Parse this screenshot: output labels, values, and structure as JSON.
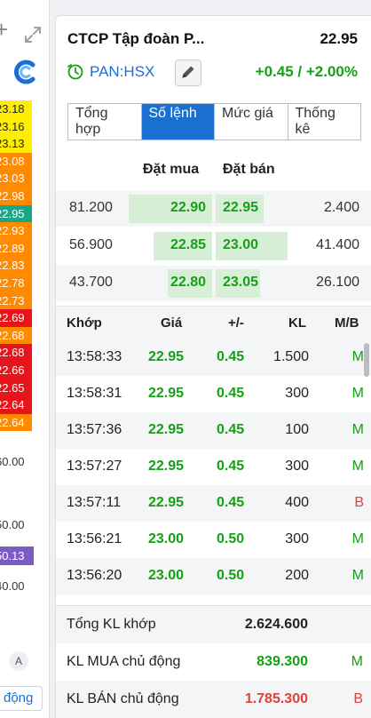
{
  "left_strip": {
    "price_tags": [
      {
        "text": "23.18",
        "bg": "#ffee00",
        "fg": "#222222"
      },
      {
        "text": "23.16",
        "bg": "#ffee00",
        "fg": "#222222"
      },
      {
        "text": "23.13",
        "bg": "#ffee00",
        "fg": "#222222"
      },
      {
        "text": "23.08",
        "bg": "#ff8a00",
        "fg": "#ffffff"
      },
      {
        "text": "23.03",
        "bg": "#ff8a00",
        "fg": "#ffffff"
      },
      {
        "text": "22.98",
        "bg": "#ff8a00",
        "fg": "#ffffff"
      },
      {
        "text": "22.95",
        "bg": "#16a889",
        "fg": "#ffffff"
      },
      {
        "text": "22.93",
        "bg": "#ff8a00",
        "fg": "#ffffff"
      },
      {
        "text": "22.89",
        "bg": "#ff8a00",
        "fg": "#ffffff"
      },
      {
        "text": "22.83",
        "bg": "#ff8a00",
        "fg": "#ffffff"
      },
      {
        "text": "22.78",
        "bg": "#ff8a00",
        "fg": "#ffffff"
      },
      {
        "text": "22.73",
        "bg": "#ff8a00",
        "fg": "#ffffff"
      },
      {
        "text": "22.69",
        "bg": "#e8141c",
        "fg": "#ffffff"
      },
      {
        "text": "22.68",
        "bg": "#ff8a00",
        "fg": "#ffffff"
      },
      {
        "text": "22.68",
        "bg": "#e8141c",
        "fg": "#ffffff"
      },
      {
        "text": "22.66",
        "bg": "#e8141c",
        "fg": "#ffffff"
      },
      {
        "text": "22.65",
        "bg": "#e8141c",
        "fg": "#ffffff"
      },
      {
        "text": "22.64",
        "bg": "#e8141c",
        "fg": "#ffffff"
      },
      {
        "text": "22.64",
        "bg": "#ff8a00",
        "fg": "#ffffff"
      }
    ],
    "axis_labels": [
      "60.00",
      "50.00",
      "40.00"
    ],
    "volume_tag": "50.13",
    "a_button": "A",
    "dong_button": "động"
  },
  "header": {
    "name": "CTCP Tập đoàn P...",
    "price": "22.95",
    "exchange": "PAN:HSX",
    "change": "+0.45 / +2.00%"
  },
  "tabs": [
    {
      "label": "Tổng hợp",
      "active": false
    },
    {
      "label": "Số lệnh",
      "active": true
    },
    {
      "label": "Mức giá",
      "active": false
    },
    {
      "label": "Thống kê",
      "active": false
    }
  ],
  "orderbook": {
    "bid_header": "Đặt mua",
    "ask_header": "Đặt bán",
    "rows": [
      {
        "bid_vol": "81.200",
        "bid_price": "22.90",
        "bid_fill": 0.94,
        "ask_price": "22.95",
        "ask_fill": 0.3,
        "ask_vol": "2.400"
      },
      {
        "bid_vol": "56.900",
        "bid_price": "22.85",
        "bid_fill": 0.66,
        "ask_price": "23.00",
        "ask_fill": 0.45,
        "ask_vol": "41.400"
      },
      {
        "bid_vol": "43.700",
        "bid_price": "22.80",
        "bid_fill": 0.5,
        "ask_price": "23.05",
        "ask_fill": 0.28,
        "ask_vol": "26.100"
      }
    ]
  },
  "trades": {
    "headers": {
      "time": "Khớp",
      "price": "Giá",
      "change": "+/-",
      "volume": "KL",
      "side": "M/B"
    },
    "rows": [
      {
        "time": "13:58:33",
        "price": "22.95",
        "change": "0.45",
        "volume": "1.500",
        "side": "M"
      },
      {
        "time": "13:58:31",
        "price": "22.95",
        "change": "0.45",
        "volume": "300",
        "side": "M"
      },
      {
        "time": "13:57:36",
        "price": "22.95",
        "change": "0.45",
        "volume": "100",
        "side": "M"
      },
      {
        "time": "13:57:27",
        "price": "22.95",
        "change": "0.45",
        "volume": "300",
        "side": "M"
      },
      {
        "time": "13:57:11",
        "price": "22.95",
        "change": "0.45",
        "volume": "400",
        "side": "B"
      },
      {
        "time": "13:56:21",
        "price": "23.00",
        "change": "0.50",
        "volume": "300",
        "side": "M"
      },
      {
        "time": "13:56:20",
        "price": "23.00",
        "change": "0.50",
        "volume": "200",
        "side": "M"
      }
    ]
  },
  "summary": [
    {
      "label": "Tổng KL khớp",
      "value": "2.624.600",
      "side": "",
      "color": "#222222"
    },
    {
      "label": "KL MUA chủ động",
      "value": "839.300",
      "side": "M",
      "color": "#14a114"
    },
    {
      "label": "KL BÁN chủ động",
      "value": "1.785.300",
      "side": "B",
      "color": "#e0413a"
    }
  ],
  "colors": {
    "up": "#14a114",
    "down": "#e0413a",
    "accent": "#1a6fd1"
  }
}
